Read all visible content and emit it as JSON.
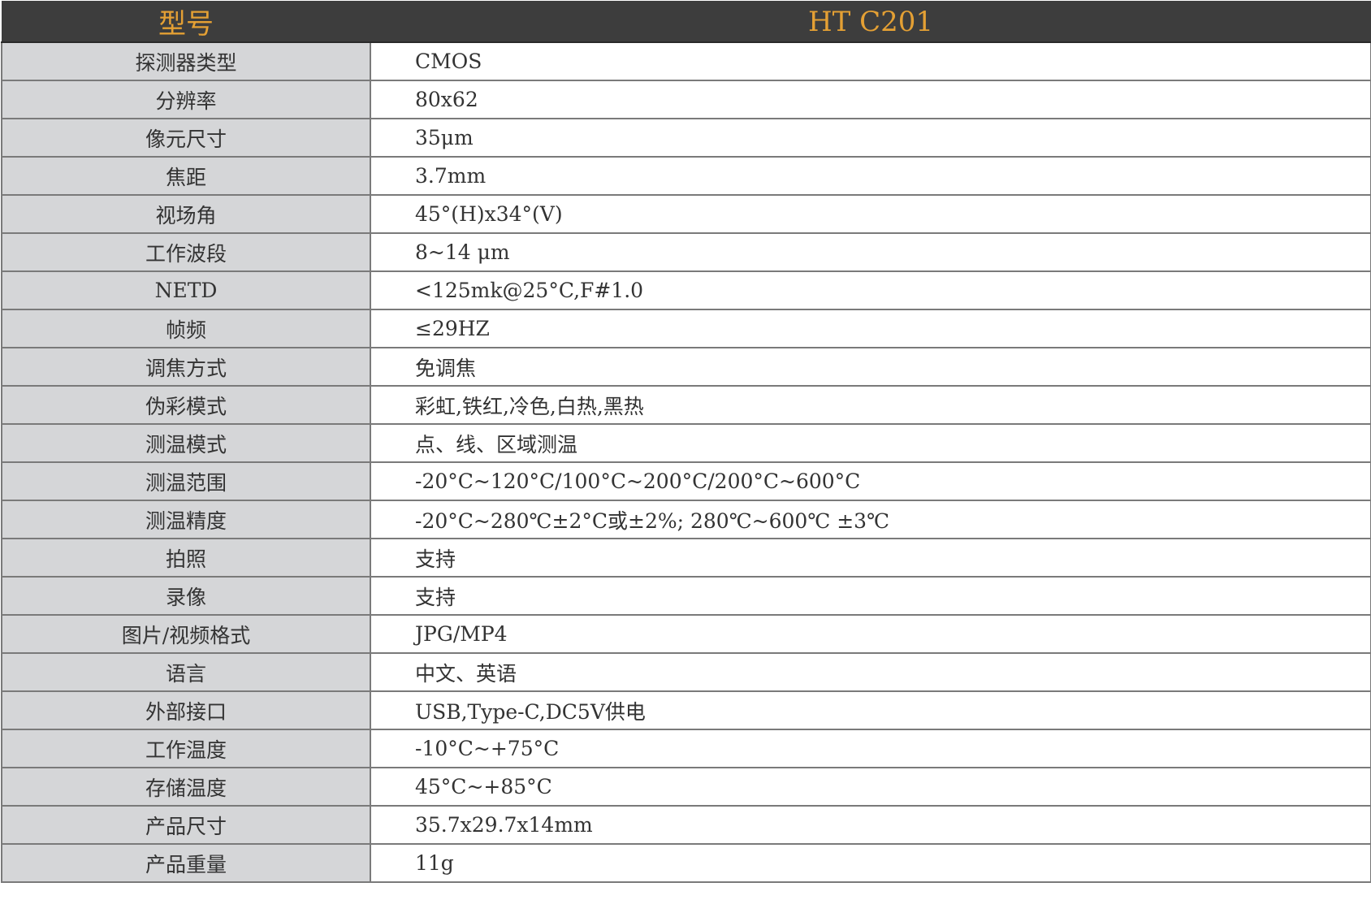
{
  "header": {
    "label": "型号",
    "value": "HT C201"
  },
  "rows": [
    {
      "label": "探测器类型",
      "value": "CMOS"
    },
    {
      "label": "分辨率",
      "value": "80x62"
    },
    {
      "label": "像元尺寸",
      "value": "35μm"
    },
    {
      "label": "焦距",
      "value": "3.7mm"
    },
    {
      "label": "视场角",
      "value": "45°(H)x34°(V)"
    },
    {
      "label": "工作波段",
      "value": "8~14 μm"
    },
    {
      "label": "NETD",
      "value": "<125mk@25°C,F#1.0"
    },
    {
      "label": "帧频",
      "value": "≤29HZ"
    },
    {
      "label": "调焦方式",
      "value": "免调焦"
    },
    {
      "label": "伪彩模式",
      "value": "彩虹,铁红,冷色,白热,黑热"
    },
    {
      "label": "测温模式",
      "value": "点、线、区域测温"
    },
    {
      "label": "测温范围",
      "value": "-20°C~120°C/100°C~200°C/200°C~600°C"
    },
    {
      "label": "测温精度",
      "value": "-20°C~280℃±2°C或±2%; 280℃~600℃ ±3℃"
    },
    {
      "label": "拍照",
      "value": "支持"
    },
    {
      "label": "录像",
      "value": "支持"
    },
    {
      "label": "图片/视频格式",
      "value": "JPG/MP4"
    },
    {
      "label": "语言",
      "value": "中文、英语"
    },
    {
      "label": "外部接口",
      "value": "USB,Type-C,DC5V供电"
    },
    {
      "label": "工作温度",
      "value": "-10°C~+75°C"
    },
    {
      "label": "存储温度",
      "value": "45°C~+85°C"
    },
    {
      "label": "产品尺寸",
      "value": "35.7x29.7x14mm"
    },
    {
      "label": "产品重量",
      "value": "11g"
    }
  ]
}
